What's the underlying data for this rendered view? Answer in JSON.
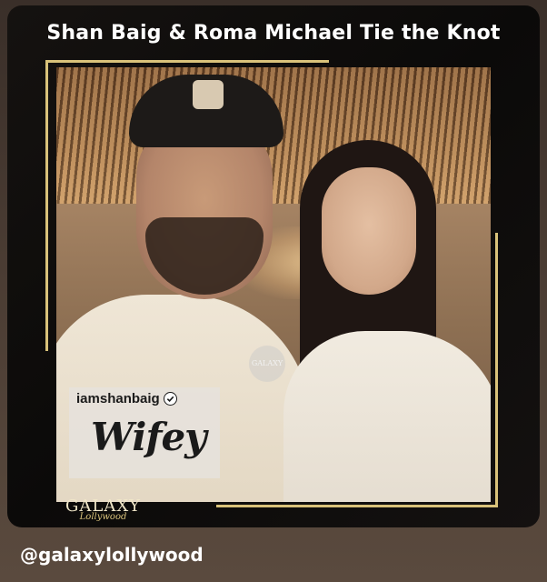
{
  "card": {
    "title": "Shan Baig & Roma Michael Tie the Knot"
  },
  "photo": {
    "watermark": "GALAXY",
    "story_sticker": {
      "handle": "iamshanbaig",
      "verified_icon": "verified-badge-icon",
      "text": "Wifey"
    }
  },
  "brand": {
    "name": "GALAXY",
    "tagline": "Lollywood"
  },
  "footer": {
    "handle": "@galaxylollywood"
  },
  "colors": {
    "frame_accent": "#d9c27a",
    "card_background": "#0b0a09",
    "title_text": "#ffffff"
  }
}
